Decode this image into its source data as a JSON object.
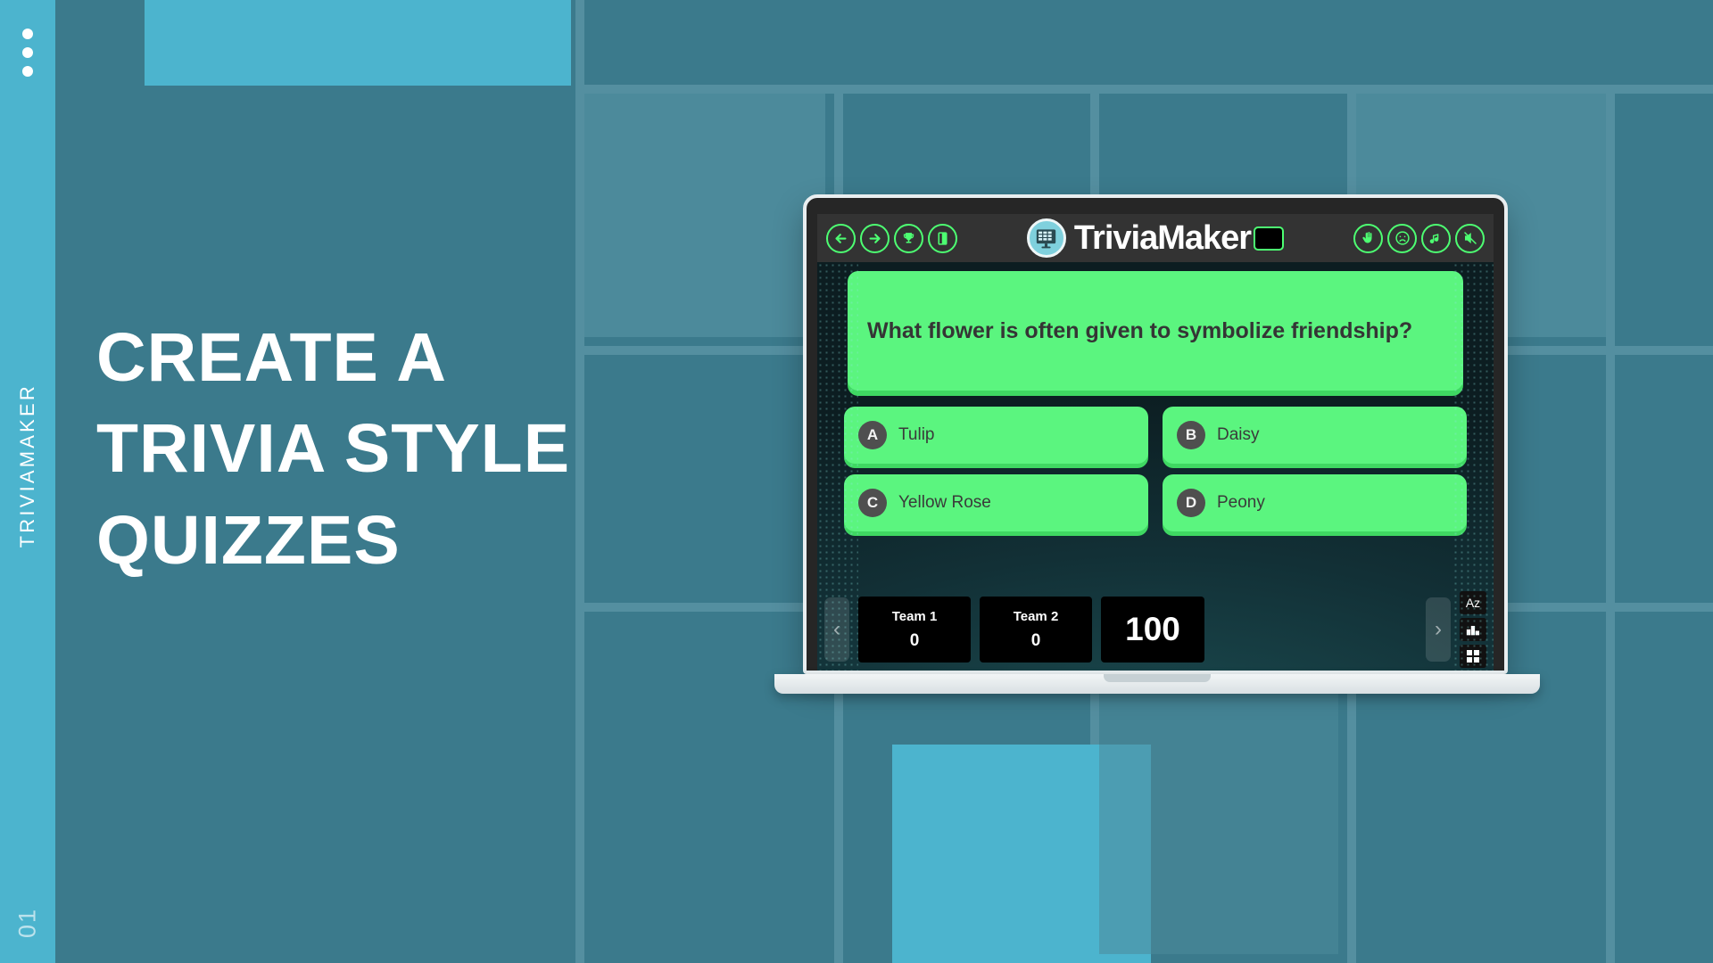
{
  "slide": {
    "rail": {
      "vertical_label": "TRIVIAMAKER",
      "slide_number": "01",
      "dot_count": 3,
      "accent_color": "#4cb4ce"
    },
    "headline_lines": [
      "Create a",
      "Trivia Style",
      "Quizzes"
    ],
    "background_color": "#3b7a8c",
    "accent_block_color": "#4cb4ce"
  },
  "app": {
    "brand": {
      "name": "TriviaMaker",
      "logo_icon": "grid-monitor-icon",
      "logo_bg": "#7fd0dd"
    },
    "toolbar": {
      "accent_color": "#4dff72",
      "left_icons": [
        {
          "name": "back-arrow-icon",
          "glyph": "←"
        },
        {
          "name": "forward-arrow-icon",
          "glyph": "→"
        },
        {
          "name": "trophy-icon",
          "glyph": "Ἴ6"
        },
        {
          "name": "exit-door-icon",
          "glyph": "▮"
        }
      ],
      "heart_chip": {
        "name": "heart-reaction-chip",
        "glyph": "❤"
      },
      "right_icons": [
        {
          "name": "clap-hand-icon",
          "glyph": "✋"
        },
        {
          "name": "sad-face-icon",
          "glyph": "☹"
        },
        {
          "name": "music-note-icon",
          "glyph": "♪"
        },
        {
          "name": "mute-speaker-icon",
          "glyph": "ὐ7"
        }
      ]
    },
    "quiz": {
      "question": "What flower is often given to symbolize friendship?",
      "answers": [
        {
          "key": "A",
          "text": "Tulip"
        },
        {
          "key": "B",
          "text": "Daisy"
        },
        {
          "key": "C",
          "text": "Yellow Rose"
        },
        {
          "key": "D",
          "text": "Peony"
        }
      ],
      "answer_bg": "#5bf57f",
      "answer_shadow": "#3fd862"
    },
    "scorebar": {
      "prev_glyph": "‹",
      "next_glyph": "›",
      "teams": [
        {
          "name": "Team 1",
          "score": "0"
        },
        {
          "name": "Team 2",
          "score": "0"
        }
      ],
      "points_value": "100",
      "tools": [
        {
          "name": "sort-az-button",
          "label": "Az"
        },
        {
          "name": "leaderboard-button",
          "label": "Ἴ5"
        },
        {
          "name": "grid-view-button",
          "label": "grid"
        }
      ]
    }
  }
}
